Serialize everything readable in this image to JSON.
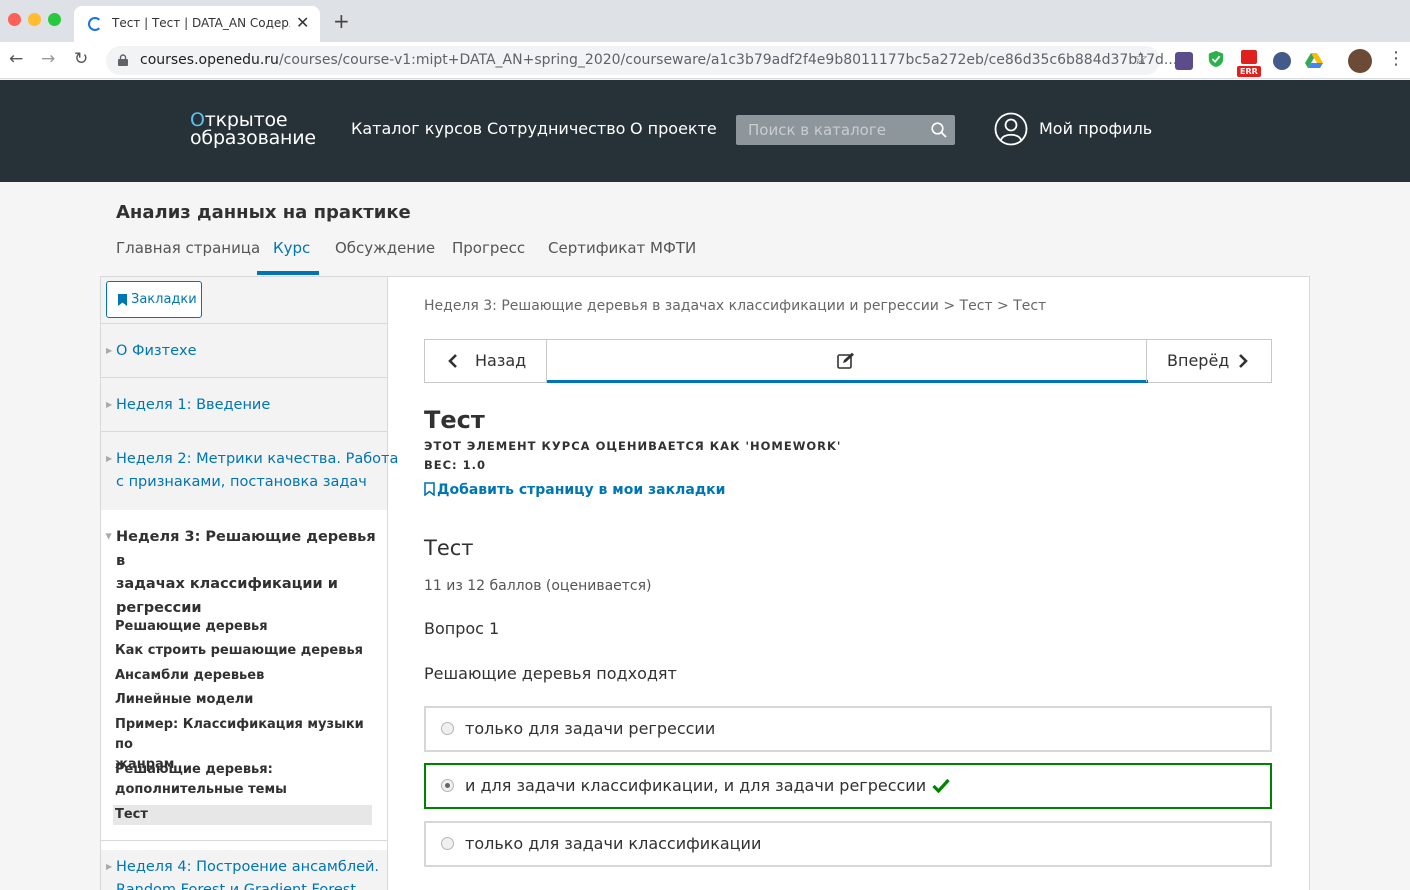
{
  "browser": {
    "tab_title": "Тест | Тест | DATA_AN Содержание",
    "tab_close": "✕",
    "new_tab": "+",
    "url_host": "courses.openedu.ru",
    "url_path": "/courses/course-v1:mipt+DATA_AN+spring_2020/courseware/a1c3b79adf2f4e9b8011177bc5a272eb/ce86d35c6b884d37b17d...",
    "back": "←",
    "forward": "→",
    "reload": "↻",
    "star": "☆",
    "ext_badge": "ERR",
    "menu": "⋮"
  },
  "header": {
    "logo_line1": "ткрытое",
    "logo_o": "О",
    "logo_line2": "образование",
    "nav": [
      "Каталог курсов",
      "Сотрудничество",
      "О проекте"
    ],
    "search_placeholder": "Поиск в каталоге",
    "profile_label": "Мой профиль"
  },
  "course": {
    "title": "Анализ данных на практике",
    "tabs": [
      "Главная страница",
      "Курс",
      "Обсуждение",
      "Прогресс",
      "Сертификат МФТИ"
    ],
    "active_tab": "Курс"
  },
  "sidebar": {
    "bookmarks_label": "Закладки",
    "sections": [
      {
        "label": "О Физтехе"
      },
      {
        "label_lines": [
          "Неделя 1: Введение"
        ]
      },
      {
        "label_lines": [
          "Неделя 2: Метрики качества. Работа",
          "с признаками, постановка задач"
        ]
      },
      {
        "label_lines": [
          "Неделя 3: Решающие деревья в",
          "задачах классификации и",
          "регрессии"
        ]
      },
      {
        "label_lines": [
          "Неделя 4: Построение ансамблей.",
          "Random Forest и Gradient Forest"
        ]
      }
    ],
    "subsections": [
      "Решающие деревья",
      "Как строить решающие деревья",
      "Ансамбли деревьев",
      "Линейные модели",
      "Пример: Классификация музыки по",
      "жанрам",
      "Решающие деревья:",
      "дополнительные темы",
      "Тест"
    ]
  },
  "content": {
    "breadcrumbs": "Неделя 3: Решающие деревья в задачах классификации и регрессии > Тест > Тест",
    "prev_label": "Назад",
    "next_label": "Вперёд",
    "unit_title": "Тест",
    "graded_as": "Этот элемент курса оценивается как 'Homework'",
    "weight": "Вес: 1.0",
    "add_bookmark": "Добавить страницу в мои закладки",
    "problem_title": "Тест",
    "score": "11 из 12 баллов (оценивается)",
    "question_label": "Вопрос 1",
    "question_text": "Решающие деревья подходят",
    "options": [
      {
        "label": "только для задачи регрессии",
        "selected": false,
        "correct": false
      },
      {
        "label": "и для задачи классификации, и для задачи регрессии",
        "selected": true,
        "correct": true
      },
      {
        "label": "только для задачи классификации",
        "selected": false,
        "correct": false
      }
    ]
  },
  "colors": {
    "header_bg": "#263238",
    "link_blue": "#0075b4",
    "correct_green": "#008100"
  }
}
